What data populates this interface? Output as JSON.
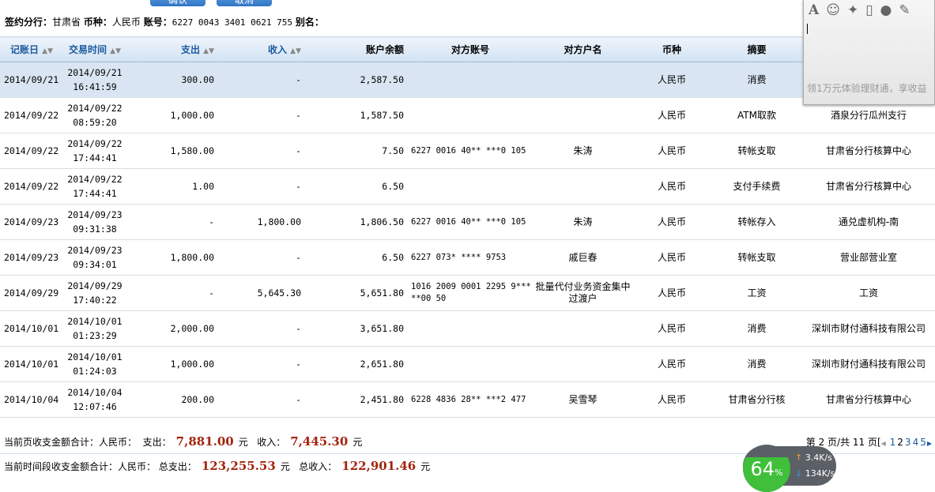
{
  "buttons": {
    "confirm": "确认",
    "cancel": "取消"
  },
  "info": {
    "branch_label": "签约分行：",
    "branch": "甘肃省",
    "currency_label": "币种：",
    "currency": "人民币",
    "account_label": "账号：",
    "account": "6227 0043 3401 0621 755",
    "alias_label": "别名："
  },
  "columns": [
    "记账日",
    "交易时间",
    "支出",
    "收入",
    "账户余额",
    "对方账号",
    "对方户名",
    "币种",
    "摘要"
  ],
  "rows": [
    {
      "date": "2014/09/21",
      "tdate": "2014/09/21",
      "ttime": "16:41:59",
      "out": "300.00",
      "in": "-",
      "bal": "2,587.50",
      "acct": "",
      "name": "",
      "cur": "人民币",
      "memo": "消费",
      "place": ""
    },
    {
      "date": "2014/09/22",
      "tdate": "2014/09/22",
      "ttime": "08:59:20",
      "out": "1,000.00",
      "in": "-",
      "bal": "1,587.50",
      "acct": "",
      "name": "",
      "cur": "人民币",
      "memo": "ATM取款",
      "place": "酒泉分行瓜州支行"
    },
    {
      "date": "2014/09/22",
      "tdate": "2014/09/22",
      "ttime": "17:44:41",
      "out": "1,580.00",
      "in": "-",
      "bal": "7.50",
      "acct": "6227 0016 40** ***0 105",
      "name": "朱涛",
      "cur": "人民币",
      "memo": "转帐支取",
      "place": "甘肃省分行核算中心"
    },
    {
      "date": "2014/09/22",
      "tdate": "2014/09/22",
      "ttime": "17:44:41",
      "out": "1.00",
      "in": "-",
      "bal": "6.50",
      "acct": "",
      "name": "",
      "cur": "人民币",
      "memo": "支付手续费",
      "place": "甘肃省分行核算中心"
    },
    {
      "date": "2014/09/23",
      "tdate": "2014/09/23",
      "ttime": "09:31:38",
      "out": "-",
      "in": "1,800.00",
      "bal": "1,806.50",
      "acct": "6227 0016 40** ***0 105",
      "name": "朱涛",
      "cur": "人民币",
      "memo": "转帐存入",
      "place": "通兑虚机构-南"
    },
    {
      "date": "2014/09/23",
      "tdate": "2014/09/23",
      "ttime": "09:34:01",
      "out": "1,800.00",
      "in": "-",
      "bal": "6.50",
      "acct": "6227 073* **** 9753",
      "name": "戚巨春",
      "cur": "人民币",
      "memo": "转帐支取",
      "place": "营业部营业室"
    },
    {
      "date": "2014/09/29",
      "tdate": "2014/09/29",
      "ttime": "17:40:22",
      "out": "-",
      "in": "5,645.30",
      "bal": "5,651.80",
      "acct": "1016 2009 0001 2295 9*** **00 50",
      "name": "批量代付业务资金集中过渡户",
      "cur": "人民币",
      "memo": "工资",
      "place": "工资"
    },
    {
      "date": "2014/10/01",
      "tdate": "2014/10/01",
      "ttime": "01:23:29",
      "out": "2,000.00",
      "in": "-",
      "bal": "3,651.80",
      "acct": "",
      "name": "",
      "cur": "人民币",
      "memo": "消费",
      "place": "深圳市财付通科技有限公司"
    },
    {
      "date": "2014/10/01",
      "tdate": "2014/10/01",
      "ttime": "01:24:03",
      "out": "1,000.00",
      "in": "-",
      "bal": "2,651.80",
      "acct": "",
      "name": "",
      "cur": "人民币",
      "memo": "消费",
      "place": "深圳市财付通科技有限公司"
    },
    {
      "date": "2014/10/04",
      "tdate": "2014/10/04",
      "ttime": "12:07:46",
      "out": "200.00",
      "in": "-",
      "bal": "2,451.80",
      "acct": "6228 4836 28** ***2 477",
      "name": "吴雪琴",
      "cur": "人民币",
      "memo": "甘肃省分行核",
      "place": "甘肃省分行核算中心"
    }
  ],
  "summary": {
    "page_label": "当前页收支金额合计：人民币：",
    "out_label": "支出：",
    "page_out": "7,881.00",
    "unit": "元",
    "in_label": "收入：",
    "page_in": "7,445.30",
    "period_label": "当前时间段收支金额合计：人民币：",
    "total_out_label": "总支出：",
    "total_out": "123,255.53",
    "total_in_label": "总收入：",
    "total_in": "122,901.46"
  },
  "pager": {
    "text": "第 2 页/共 11 页[",
    "pages": [
      "1",
      "2",
      "3",
      "4",
      "5"
    ]
  },
  "popup": {
    "hint": "领1万元体验理财通，享收益"
  },
  "speed": {
    "percent": "64",
    "pct_sign": "%",
    "up": "3.4K/s",
    "down": "134K/s"
  }
}
